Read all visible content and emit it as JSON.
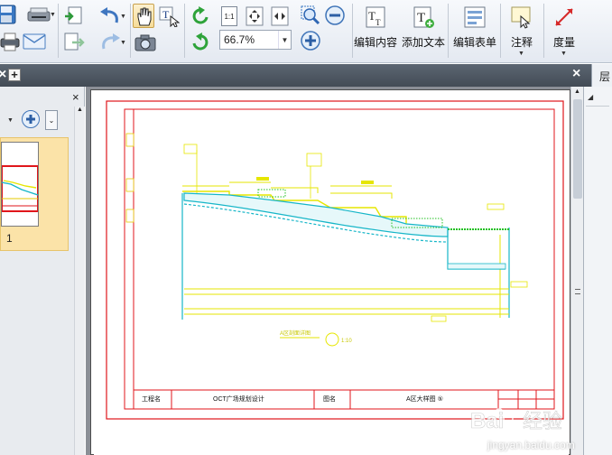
{
  "toolbar": {
    "zoom_value": "66.7%",
    "edit_content_label": "编辑内容",
    "add_text_label": "添加文本",
    "edit_form_label": "编辑表单",
    "annotate_label": "注释",
    "measure_label": "度量",
    "fit_1to1_label": "1:1"
  },
  "tabs": {
    "close_glyph": "×",
    "add_glyph": "+",
    "right_close_glyph": "×"
  },
  "left_panel": {
    "close_glyph": "×",
    "page_number": "1"
  },
  "right_panel": {
    "header_label": "层"
  },
  "drawing": {
    "project_label": "工程名",
    "project_name": "OCT广场规划设计",
    "drawing_label": "图名",
    "drawing_name": "A区大样图 ⑤",
    "section_title": "A区剖面详图",
    "scale_label": "1:10"
  },
  "watermark": {
    "text": "Bai经验",
    "url": "jingyan.baidu.com"
  },
  "colors": {
    "accent_selected": "#f6dc98",
    "border_red": "#e0161b",
    "drawing_yellow": "#e6e600",
    "drawing_cyan": "#16b6c8",
    "drawing_green": "#22c022"
  }
}
